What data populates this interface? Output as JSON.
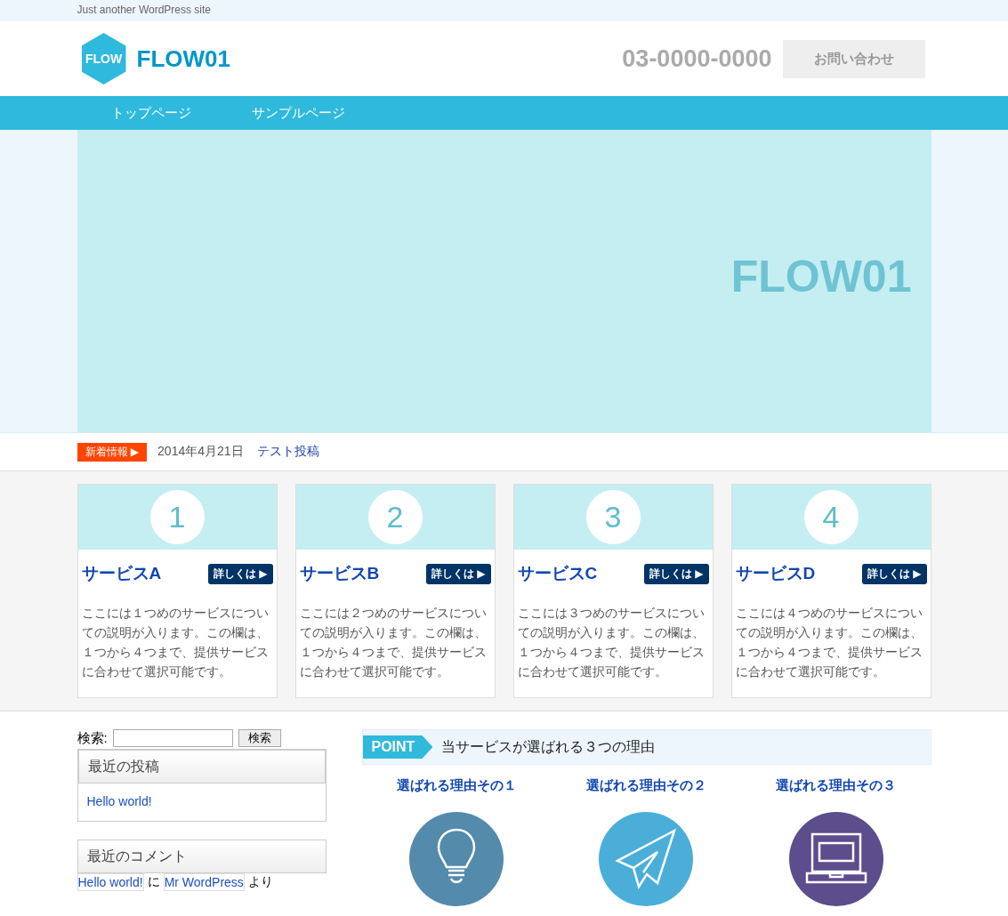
{
  "tagline": "Just another WordPress site",
  "logo": {
    "mark": "FLOW",
    "title": "FLOW01"
  },
  "phone": "03-0000-0000",
  "contact_button": "お問い合わせ",
  "nav": [
    {
      "label": "トップページ"
    },
    {
      "label": "サンプルページ"
    }
  ],
  "hero": {
    "text": "FLOW01"
  },
  "news": {
    "badge": "新着情報 ▶",
    "date": "2014年4月21日",
    "title": "テスト投稿"
  },
  "services": [
    {
      "number": "1",
      "title": "サービスA",
      "button": "詳しくは ▶",
      "description": "ここには１つめのサービスについての説明が入ります。この欄は、１つから４つまで、提供サービスに合わせて選択可能です。"
    },
    {
      "number": "2",
      "title": "サービスB",
      "button": "詳しくは ▶",
      "description": "ここには２つめのサービスについての説明が入ります。この欄は、１つから４つまで、提供サービスに合わせて選択可能です。"
    },
    {
      "number": "3",
      "title": "サービスC",
      "button": "詳しくは ▶",
      "description": "ここには３つめのサービスについての説明が入ります。この欄は、１つから４つまで、提供サービスに合わせて選択可能です。"
    },
    {
      "number": "4",
      "title": "サービスD",
      "button": "詳しくは ▶",
      "description": "ここには４つめのサービスについての説明が入ります。この欄は、１つから４つまで、提供サービスに合わせて選択可能です。"
    }
  ],
  "sidebar": {
    "search": {
      "label": "検索:",
      "button": "検索"
    },
    "recent_posts": {
      "title": "最近の投稿",
      "items": [
        "Hello world!"
      ]
    },
    "recent_comments": {
      "title": "最近のコメント",
      "post": "Hello world!",
      "on": "に",
      "author": "Mr WordPress",
      "by": "より"
    }
  },
  "point": {
    "badge": "POINT",
    "heading": "当サービスが選ばれる３つの理由",
    "reasons": [
      {
        "title": "選ばれる理由その１",
        "color": "#548aab"
      },
      {
        "title": "選ばれる理由その２",
        "color": "#4aaed9"
      },
      {
        "title": "選ばれる理由その３",
        "color": "#5c4d8c"
      }
    ]
  }
}
